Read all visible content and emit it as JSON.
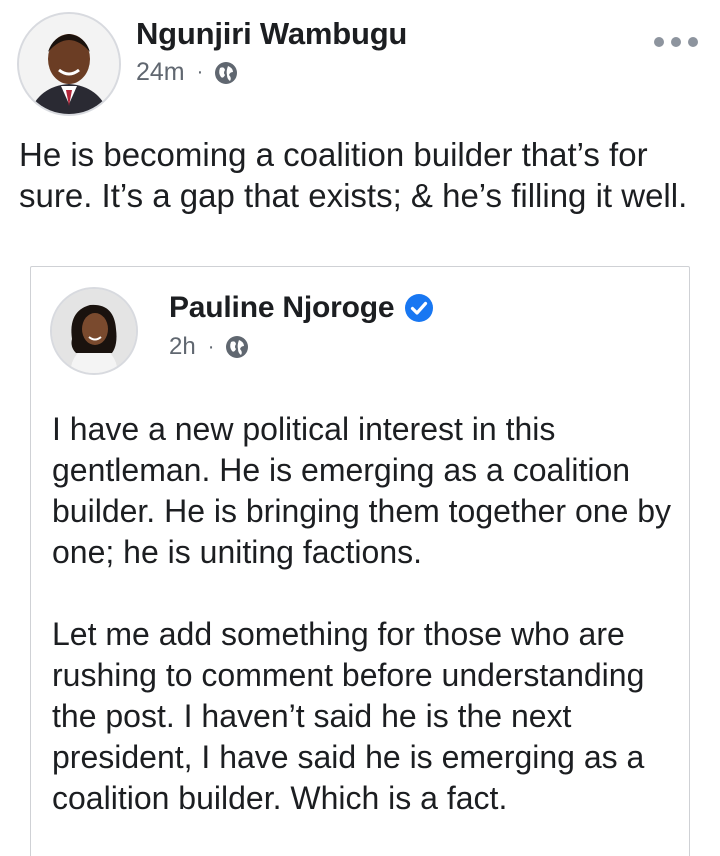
{
  "post": {
    "author": "Ngunjiri Wambugu",
    "time": "24m",
    "separator": "·",
    "privacy_icon": "globe-icon",
    "more_icon": "more-horizontal-icon",
    "text": "He is becoming a coalition builder that’s for sure. It’s a gap that exists; & he’s filling it well."
  },
  "shared_post": {
    "author": "Pauline Njoroge",
    "verified_icon": "verified-badge-icon",
    "time": "2h",
    "separator": "·",
    "privacy_icon": "globe-icon",
    "paragraphs": [
      "I have a new political interest in this gentleman. He is emerging as a coalition builder. He is bringing them together one by one; he is uniting factions.",
      "Let me add something for those who are rushing to comment before understanding the post. I haven’t said he is the next president, I have said he is emerging as a coalition builder. Which is a fact."
    ]
  },
  "colors": {
    "text": "#1c1e21",
    "meta": "#606770",
    "verified": "#1877f2",
    "card_border": "#cfd1d5"
  }
}
